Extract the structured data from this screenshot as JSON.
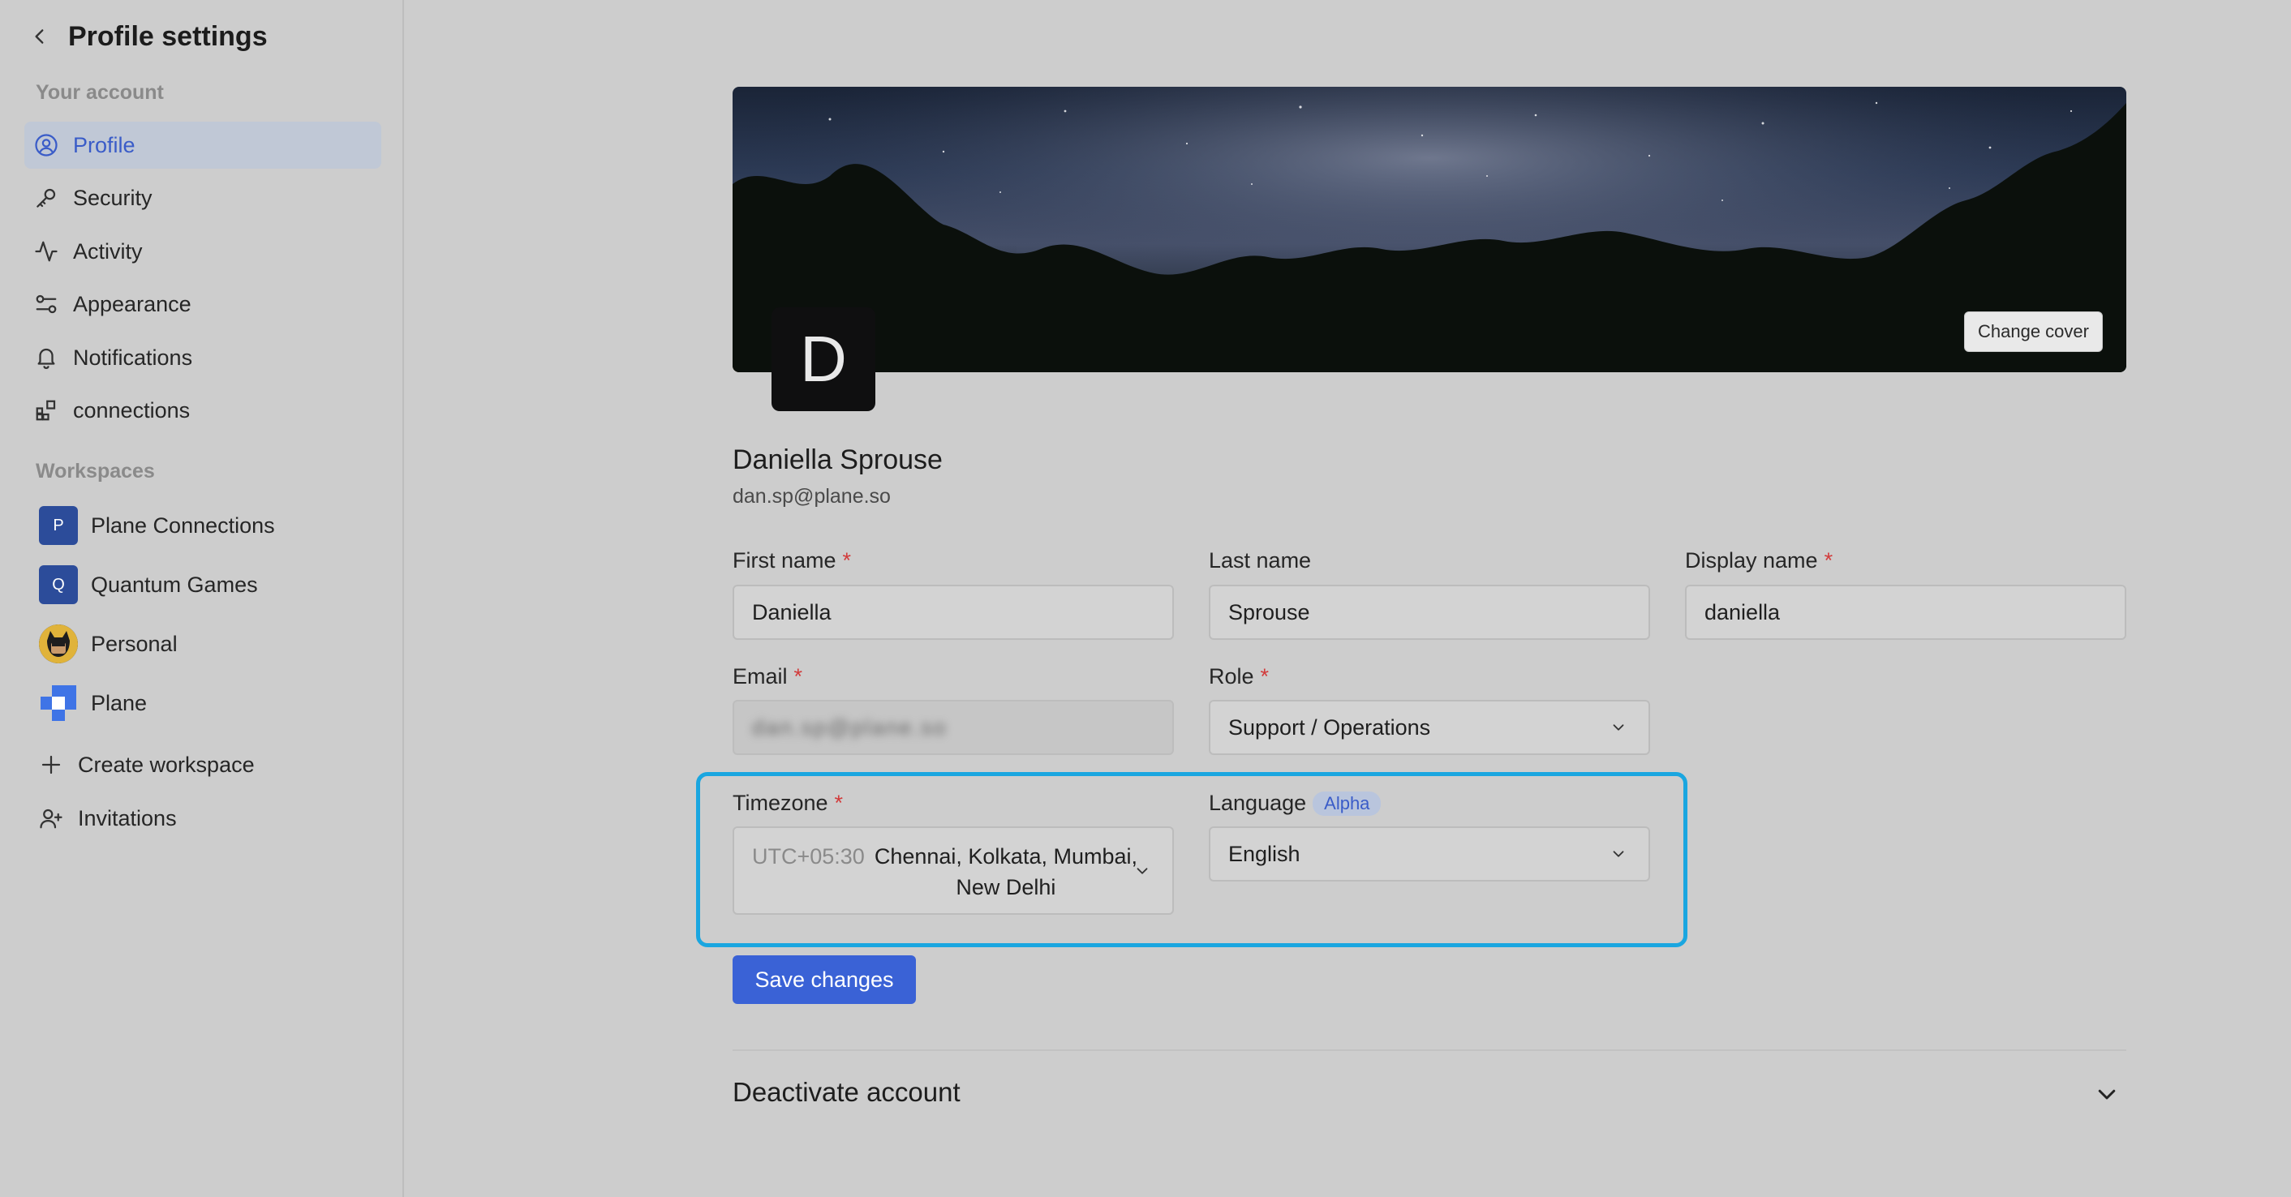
{
  "sidebar": {
    "title": "Profile settings",
    "account_section": "Your account",
    "items": [
      {
        "label": "Profile",
        "icon": "user-circle-icon"
      },
      {
        "label": "Security",
        "icon": "key-icon"
      },
      {
        "label": "Activity",
        "icon": "activity-icon"
      },
      {
        "label": "Appearance",
        "icon": "sliders-icon"
      },
      {
        "label": "Notifications",
        "icon": "bell-icon"
      },
      {
        "label": "connections",
        "icon": "blocks-icon"
      }
    ],
    "workspaces_section": "Workspaces",
    "workspaces": [
      {
        "label": "Plane Connections",
        "initial": "P"
      },
      {
        "label": "Quantum Games",
        "initial": "Q"
      },
      {
        "label": "Personal",
        "initial": ""
      },
      {
        "label": "Plane",
        "initial": ""
      }
    ],
    "create_workspace": "Create workspace",
    "invitations": "Invitations"
  },
  "profile": {
    "change_cover": "Change cover",
    "avatar_initial": "D",
    "name": "Daniella Sprouse",
    "email": "dan.sp@plane.so"
  },
  "form": {
    "first_name_label": "First name",
    "first_name_value": "Daniella",
    "last_name_label": "Last name",
    "last_name_value": "Sprouse",
    "display_name_label": "Display name",
    "display_name_value": "daniella",
    "email_label": "Email",
    "email_value": "dan.sp@plane.so",
    "role_label": "Role",
    "role_value": "Support / Operations",
    "timezone_label": "Timezone",
    "timezone_offset": "UTC+05:30",
    "timezone_line1": "Chennai, Kolkata, Mumbai,",
    "timezone_line2": "New Delhi",
    "language_label": "Language",
    "language_badge": "Alpha",
    "language_value": "English",
    "required_mark": "*"
  },
  "actions": {
    "save": "Save changes",
    "deactivate": "Deactivate account"
  },
  "colors": {
    "accent": "#3a62d6",
    "highlight": "#1aa6e0",
    "required": "#d23b3b"
  }
}
